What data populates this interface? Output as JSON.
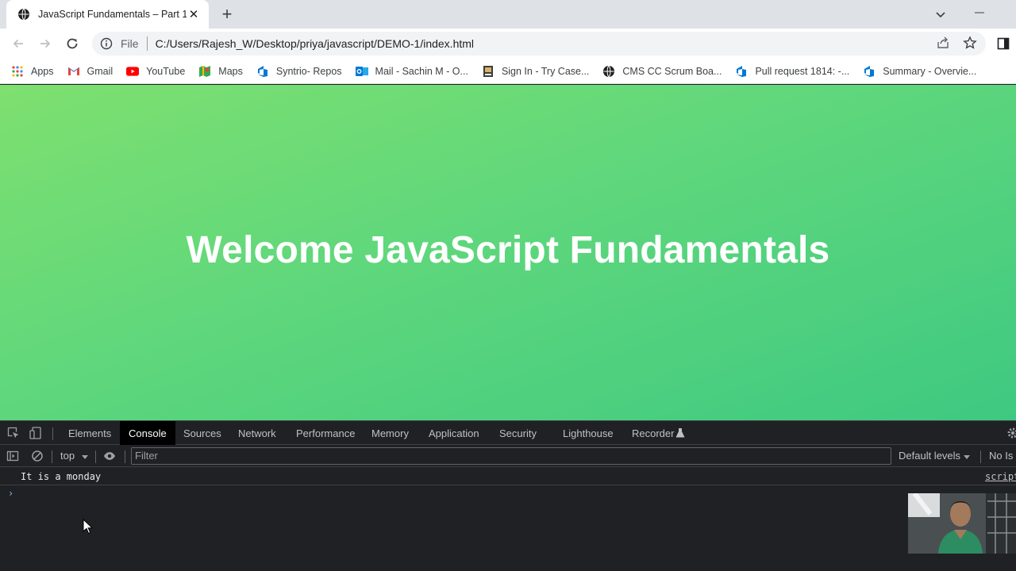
{
  "tab": {
    "title": "JavaScript Fundamentals – Part 1",
    "close": "✕",
    "new_tab": "+"
  },
  "toolbar": {
    "scheme_label": "File",
    "url": "C:/Users/Rajesh_W/Desktop/priya/javascript/DEMO-1/index.html"
  },
  "bookmarks": [
    {
      "label": "Apps",
      "icon": "apps-grid-icon"
    },
    {
      "label": "Gmail",
      "icon": "gmail-icon"
    },
    {
      "label": "YouTube",
      "icon": "youtube-icon"
    },
    {
      "label": "Maps",
      "icon": "maps-icon"
    },
    {
      "label": "Syntrio- Repos",
      "icon": "azure-devops-icon"
    },
    {
      "label": "Mail - Sachin M - O...",
      "icon": "outlook-icon"
    },
    {
      "label": "Sign In - Try Case...",
      "icon": "casebook-icon"
    },
    {
      "label": "CMS CC Scrum Boa...",
      "icon": "globe-icon"
    },
    {
      "label": "Pull request 1814: -...",
      "icon": "azure-devops-icon"
    },
    {
      "label": "Summary - Overvie...",
      "icon": "azure-devops-icon"
    }
  ],
  "page": {
    "heading": "Welcome JavaScript Fundamentals"
  },
  "devtools": {
    "tabs": [
      "Elements",
      "Console",
      "Sources",
      "Network",
      "Performance",
      "Memory",
      "Application",
      "Security",
      "Lighthouse",
      "Recorder"
    ],
    "active_tab": "Console",
    "context": "top",
    "filter_placeholder": "Filter",
    "levels": "Default levels",
    "issues": "No Is",
    "log_message": "It is a monday",
    "log_source": "script",
    "prompt": "›"
  },
  "colors": {
    "gradient_start": "#7ee06f",
    "gradient_end": "#3ec981",
    "devtools_bg": "#202124",
    "prompt_blue": "#8ab4f8"
  }
}
